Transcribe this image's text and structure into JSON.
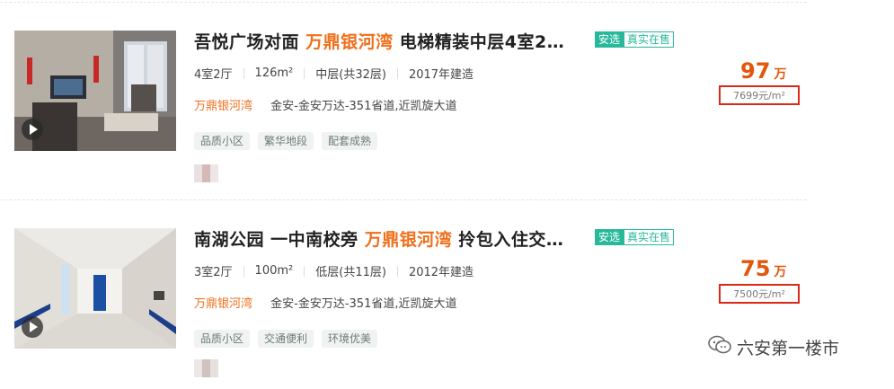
{
  "listings": [
    {
      "title_pre": "吾悦广场对面",
      "title_highlight": "万鼎银河湾",
      "title_post": "电梯精装中层4室2…",
      "badge_select": "安选",
      "badge_real": "真实在售",
      "layout": "4室2厅",
      "area": "126m²",
      "floor": "中层(共32层)",
      "built": "2017年建造",
      "community": "万鼎银河湾",
      "address": "金安-金安万达-351省道,近凯旋大道",
      "tags": [
        "品质小区",
        "繁华地段",
        "配套成熟"
      ],
      "price": "97",
      "price_unit": "万",
      "unit_price": "7699元/m²"
    },
    {
      "title_pre": "南湖公园 一中南校旁",
      "title_highlight": "万鼎银河湾",
      "title_post": "拎包入住交…",
      "badge_select": "安选",
      "badge_real": "真实在售",
      "layout": "3室2厅",
      "area": "100m²",
      "floor": "低层(共11层)",
      "built": "2012年建造",
      "community": "万鼎银河湾",
      "address": "金安-金安万达-351省道,近凯旋大道",
      "tags": [
        "品质小区",
        "交通便利",
        "环境优美"
      ],
      "price": "75",
      "price_unit": "万",
      "unit_price": "7500元/m²"
    }
  ],
  "watermark": {
    "text": "六安第一楼市",
    "icon": "wechat-icon"
  },
  "colors": {
    "highlight": "#f06f1b",
    "price": "#e2570b",
    "badge": "#27b99a",
    "annotation_box": "#d8291a"
  }
}
